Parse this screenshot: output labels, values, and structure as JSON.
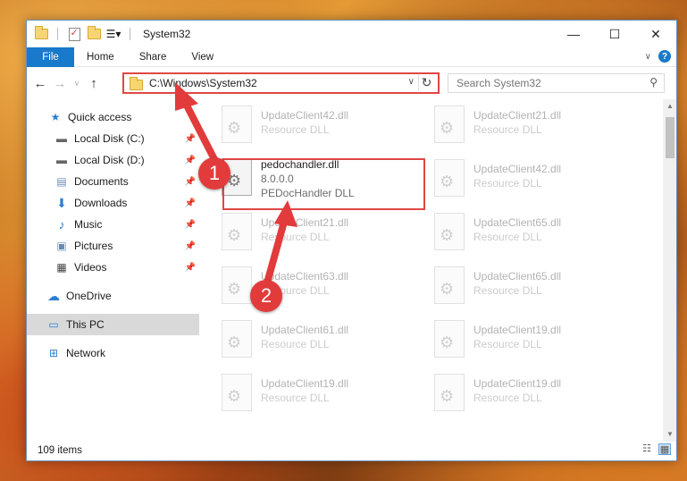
{
  "window": {
    "title": "System32"
  },
  "ribbon": {
    "tabs": [
      "File",
      "Home",
      "Share",
      "View"
    ]
  },
  "address": {
    "path": "C:\\Windows\\System32",
    "search_placeholder": "Search System32"
  },
  "sidebar": {
    "items": [
      {
        "label": "Quick access",
        "icon": "star-icon"
      },
      {
        "label": "Local Disk (C:)",
        "icon": "drive-icon"
      },
      {
        "label": "Local Disk (D:)",
        "icon": "drive-icon"
      },
      {
        "label": "Documents",
        "icon": "documents-icon"
      },
      {
        "label": "Downloads",
        "icon": "download-icon"
      },
      {
        "label": "Music",
        "icon": "music-icon"
      },
      {
        "label": "Pictures",
        "icon": "pictures-icon"
      },
      {
        "label": "Videos",
        "icon": "videos-icon"
      },
      {
        "label": "OneDrive",
        "icon": "cloud-icon"
      },
      {
        "label": "This PC",
        "icon": "computer-icon"
      },
      {
        "label": "Network",
        "icon": "network-icon"
      }
    ]
  },
  "files": [
    {
      "name": "UpdateClient42.dll",
      "desc": "Resource DLL"
    },
    {
      "name": "UpdateClient21.dll",
      "desc": "Resource DLL"
    },
    {
      "name": "pedochandler.dll",
      "version": "8.0.0.0",
      "desc": "PEDocHandler DLL"
    },
    {
      "name": "UpdateClient42.dll",
      "desc": "Resource DLL"
    },
    {
      "name": "UpdateClient21.dll",
      "desc": "Resource DLL"
    },
    {
      "name": "UpdateClient65.dll",
      "desc": "Resource DLL"
    },
    {
      "name": "UpdateClient63.dll",
      "desc": "Resource DLL"
    },
    {
      "name": "UpdateClient65.dll",
      "desc": "Resource DLL"
    },
    {
      "name": "UpdateClient61.dll",
      "desc": "Resource DLL"
    },
    {
      "name": "UpdateClient19.dll",
      "desc": "Resource DLL"
    },
    {
      "name": "UpdateClient19.dll",
      "desc": "Resource DLL"
    },
    {
      "name": "UpdateClient19.dll",
      "desc": "Resource DLL"
    }
  ],
  "status": {
    "item_count": "109 items"
  },
  "callouts": [
    "1",
    "2"
  ],
  "colors": {
    "accent": "#1979ca",
    "highlight": "#e04646"
  }
}
